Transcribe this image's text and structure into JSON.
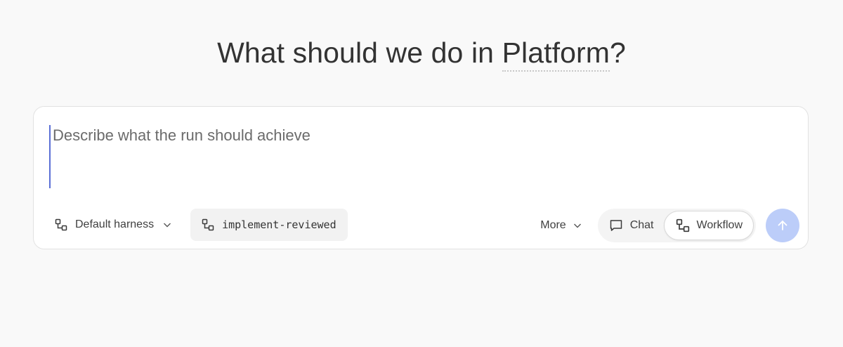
{
  "heading": {
    "prefix": "What should we do in ",
    "workspace": "Platform",
    "suffix": "?"
  },
  "composer": {
    "placeholder": "Describe what the run should achieve",
    "value": ""
  },
  "toolbar": {
    "harness_label": "Default harness",
    "harness_icon": "workflow-icon",
    "workflow_chip_label": "implement-reviewed",
    "workflow_chip_icon": "workflow-icon",
    "more_label": "More",
    "modes": [
      {
        "label": "Chat",
        "icon": "chat-bubble-icon",
        "selected": false
      },
      {
        "label": "Workflow",
        "icon": "workflow-icon",
        "selected": true
      }
    ],
    "send_icon": "arrow-up-icon"
  },
  "colors": {
    "background": "#f9f9f9",
    "send_button": "#bccdf9",
    "caret": "#5b6fd6"
  }
}
